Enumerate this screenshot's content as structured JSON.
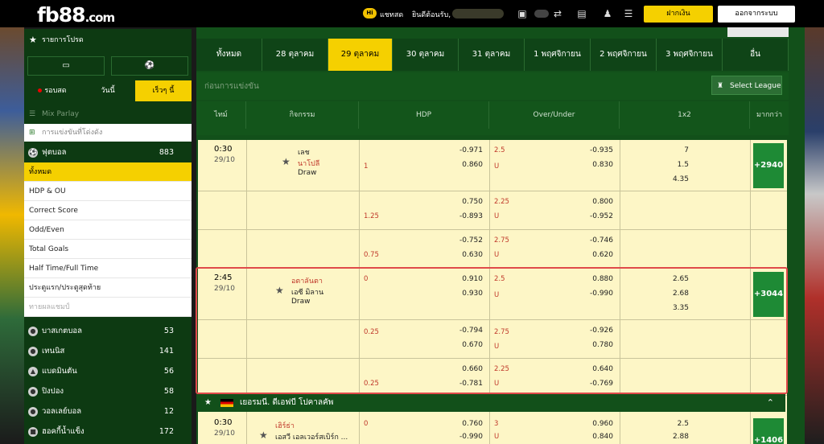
{
  "header": {
    "logo_main": "fb88",
    "logo_suffix": ".com",
    "chat_badge": "Hi",
    "chat_label": "แชทสด",
    "welcome": "ยินดีต้อนรับ,",
    "deposit": "ฝากเงิน",
    "logout": "ออกจากระบบ"
  },
  "sidebar": {
    "favorites": "รายการโปรด",
    "periods": [
      "รอบสด",
      "วันนี้",
      "เร็วๆ นี้"
    ],
    "mix_parlay": "Mix Parlay",
    "outright_search": "การแข่งขันที่โด่งดัง",
    "sports_top": {
      "name": "ฟุตบอล",
      "count": "883"
    },
    "submenu": [
      "ทั้งหมด",
      "HDP & OU",
      "Correct Score",
      "Odd/Even",
      "Total Goals",
      "Half Time/Full Time",
      "ประตูแรก/ประตูสุดท้าย",
      "ทายผลแชมป์"
    ],
    "sports": [
      {
        "name": "บาสเกตบอล",
        "count": "53"
      },
      {
        "name": "เทนนิส",
        "count": "141"
      },
      {
        "name": "แบดมินตัน",
        "count": "56"
      },
      {
        "name": "ปิงปอง",
        "count": "58"
      },
      {
        "name": "วอลเลย์บอล",
        "count": "12"
      },
      {
        "name": "ฮอคกี้น้ำแข็ง",
        "count": "172"
      }
    ]
  },
  "main": {
    "date_tabs": [
      "ทั้งหมด",
      "28 ตุลาคม",
      "29 ตุลาคม",
      "30 ตุลาคม",
      "31 ตุลาคม",
      "1 พฤศจิกายน",
      "2 พฤศจิกายน",
      "3 พฤศจิกายน",
      "อื่น"
    ],
    "section_title": "ก่อนการแข่งขัน",
    "select_league": "Select League",
    "columns": [
      "ไทม์",
      "กิจกรรม",
      "HDP",
      "Over/Under",
      "1x2",
      "มากกว่า"
    ],
    "league2": "เยอรมนี. ดีเอฟบี โปคาลคัพ"
  },
  "matches": [
    {
      "time": "0:30",
      "date": "29/10",
      "home": "เลช",
      "away": "นาโปลี",
      "draw": "Draw",
      "more": "+2940",
      "x12": [
        "7",
        "1.5",
        "4.35"
      ],
      "lines": [
        {
          "hcap": "1",
          "hdp": [
            "-0.971",
            "0.860"
          ],
          "ou_line": "2.5",
          "ou_u": "U",
          "ou": [
            "-0.935",
            "0.830"
          ]
        },
        {
          "hcap": "1.25",
          "hdp": [
            "0.750",
            "-0.893"
          ],
          "ou_line": "2.25",
          "ou_u": "U",
          "ou": [
            "0.800",
            "-0.952"
          ]
        },
        {
          "hcap": "0.75",
          "hdp": [
            "-0.752",
            "0.630"
          ],
          "ou_line": "2.75",
          "ou_u": "U",
          "ou": [
            "-0.746",
            "0.620"
          ]
        }
      ]
    },
    {
      "time": "2:45",
      "date": "29/10",
      "home": "อตาลันตา",
      "away": "เอซี มิลาน",
      "draw": "Draw",
      "more": "+3044",
      "x12": [
        "2.65",
        "2.68",
        "3.35"
      ],
      "lines": [
        {
          "hcap": "0",
          "hdp": [
            "0.910",
            "0.930"
          ],
          "ou_line": "2.5",
          "ou_u": "U",
          "ou": [
            "0.880",
            "-0.990"
          ]
        },
        {
          "hcap": "0.25",
          "hdp": [
            "-0.794",
            "0.670"
          ],
          "ou_line": "2.75",
          "ou_u": "U",
          "ou": [
            "-0.926",
            "0.780"
          ]
        },
        {
          "hcap": "0.25",
          "hdp": [
            "0.660",
            "-0.781"
          ],
          "ou_line": "2.25",
          "ou_u": "U",
          "ou": [
            "0.640",
            "-0.769"
          ]
        }
      ]
    },
    {
      "time": "0:30",
      "date": "29/10",
      "home": "เฮิร์ธ่า",
      "away": "เอสวี เอลเวอร์สเบิร์ก ...",
      "more": "+1406",
      "x12": [
        "2.5",
        "2.88"
      ],
      "lines": [
        {
          "hcap": "0",
          "hdp": [
            "0.760",
            "-0.990"
          ],
          "ou_line": "3",
          "ou_u": "U",
          "ou": [
            "0.960",
            "0.840"
          ]
        }
      ]
    }
  ],
  "colors": {
    "accent": "#f5d000",
    "green_dark": "#0d3a12",
    "green": "#12501a",
    "grid_bg": "#fdf6c6",
    "more_btn": "#1e8a35",
    "highlight": "#e04a4a"
  }
}
